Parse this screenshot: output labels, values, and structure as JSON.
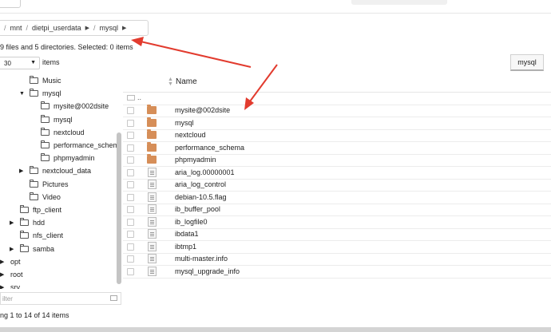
{
  "breadcrumb": [
    "mnt",
    "dietpi_userdata",
    "mysql"
  ],
  "breadcrumb_sep": "/",
  "status": "9 files and 5 directories. Selected: 0 items",
  "page_size": {
    "value": "30",
    "label": "items"
  },
  "tab": "mysql",
  "tree": [
    {
      "label": "Music",
      "level": 2,
      "expanded": null
    },
    {
      "label": "mysql",
      "level": 2,
      "expanded": true
    },
    {
      "label": "mysite@002dsite",
      "level": 3,
      "expanded": null
    },
    {
      "label": "mysql",
      "level": 3,
      "expanded": null
    },
    {
      "label": "nextcloud",
      "level": 3,
      "expanded": null
    },
    {
      "label": "performance_schema",
      "level": 3,
      "expanded": null
    },
    {
      "label": "phpmyadmin",
      "level": 3,
      "expanded": null
    },
    {
      "label": "nextcloud_data",
      "level": 2,
      "expanded": false
    },
    {
      "label": "Pictures",
      "level": 2,
      "expanded": null
    },
    {
      "label": "Video",
      "level": 2,
      "expanded": null
    },
    {
      "label": "ftp_client",
      "level": 1,
      "expanded": null
    },
    {
      "label": "hdd",
      "level": 1,
      "expanded": false
    },
    {
      "label": "nfs_client",
      "level": 1,
      "expanded": null
    },
    {
      "label": "samba",
      "level": 1,
      "expanded": false
    },
    {
      "label": "opt",
      "level": 0,
      "expanded": false
    },
    {
      "label": "root",
      "level": 0,
      "expanded": false
    },
    {
      "label": "srv",
      "level": 0,
      "expanded": false
    }
  ],
  "filter_placeholder": "ilter",
  "list_header": {
    "name": "Name",
    "updir": ".."
  },
  "files": [
    {
      "name": "mysite@002dsite",
      "type": "dir"
    },
    {
      "name": "mysql",
      "type": "dir"
    },
    {
      "name": "nextcloud",
      "type": "dir"
    },
    {
      "name": "performance_schema",
      "type": "dir"
    },
    {
      "name": "phpmyadmin",
      "type": "dir"
    },
    {
      "name": "aria_log.00000001",
      "type": "file"
    },
    {
      "name": "aria_log_control",
      "type": "file"
    },
    {
      "name": "debian-10.5.flag",
      "type": "file"
    },
    {
      "name": "ib_buffer_pool",
      "type": "file"
    },
    {
      "name": "ib_logfile0",
      "type": "file"
    },
    {
      "name": "ibdata1",
      "type": "file"
    },
    {
      "name": "ibtmp1",
      "type": "file"
    },
    {
      "name": "multi-master.info",
      "type": "file"
    },
    {
      "name": "mysql_upgrade_info",
      "type": "file"
    }
  ],
  "footer": "ng 1 to 14 of 14 items",
  "colors": {
    "folder": "#d68e58",
    "annotation": "#e23b2e"
  }
}
